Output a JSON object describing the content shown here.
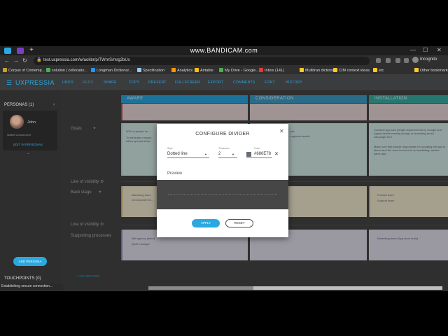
{
  "watermark": "www.BANDICAM.com",
  "browser": {
    "new_tab": "+",
    "url": "test.uxpressia.com/w/aokbr/p/TWnrS/m/g2bUs",
    "profile": "Incognito",
    "bookmarks": [
      {
        "label": "Corpus of Contemp...",
        "color": "#c9a227"
      },
      {
        "label": "solution | collocatio...",
        "color": "#4caf50"
      },
      {
        "label": "Longman Dictionar...",
        "color": "#2196f3"
      },
      {
        "label": "Specification",
        "color": "#90caf9"
      },
      {
        "label": "Analytics",
        "color": "#ff9800"
      },
      {
        "label": "Airtable",
        "color": "#ffc107"
      },
      {
        "label": "My Drive - Google...",
        "color": "#4caf50"
      },
      {
        "label": "Inbox (141)",
        "color": "#e53935"
      },
      {
        "label": "Multitran dictionary",
        "color": "#ffca28"
      },
      {
        "label": "CIM context ideas",
        "color": "#ffca28"
      },
      {
        "label": "etc",
        "color": "#ffca28"
      },
      {
        "label": "Other bookmarks",
        "color": "#ffca28"
      }
    ],
    "status": "Establishing secure connection..."
  },
  "app": {
    "brand": "UXPRESSIA",
    "toolbar": [
      {
        "label": "UNDO",
        "dim": false
      },
      {
        "label": "REDO",
        "dim": true
      },
      {
        "label": "SHARE",
        "dim": false
      },
      {
        "label": "COPY",
        "dim": false
      },
      {
        "label": "PRESENT",
        "dim": false
      },
      {
        "label": "FULLSCREEN",
        "dim": false
      },
      {
        "label": "EXPORT",
        "dim": false
      },
      {
        "label": "COMMENTS",
        "dim": false
      },
      {
        "label": "FONT",
        "dim": false
      },
      {
        "label": "HISTORY",
        "dim": false
      }
    ]
  },
  "sidebar": {
    "personas_title": "PERSONAS (1)",
    "persona": {
      "name": "John",
      "role": "Student & music lover",
      "edit": "EDIT IN PERSONAS"
    },
    "add_persona": "ADD PERSONA",
    "touchpoints_title": "TOUCHPOINTS (0)"
  },
  "map": {
    "stages": [
      {
        "label": "AWARE",
        "color": "#2aa9e0"
      },
      {
        "label": "CONSIDERATION",
        "color": "#3f9ec9"
      },
      {
        "label": "INSTALLATION",
        "color": "#37b0a6"
      }
    ],
    "rows": {
      "goals": "Goals",
      "line1": "Line of visibility",
      "backstage": "Back stage",
      "line2": "Line of visibility",
      "supporting": "Supporting processes"
    },
    "goal_texts": {
      "aware": "80% of people do...",
      "aware2": "To eliminate a negat... follow special advis...",
      "consid": "...ple",
      "consid2": "...regional results",
      "install": "Consider app size (length requirements by Google and Apple) before naming an app or launching an ad campaign for it",
      "install2": "Make sure that people responsible for updating the app to stores and the ones involved in ad marketing use the same app"
    },
    "backstage_texts": {
      "aware": "Marketing team",
      "aware2": "Development te...",
      "install": "Product team",
      "install2": "Support team"
    },
    "support_texts": {
      "aware": "Mkt agency (team)",
      "aware2": "QAM manager",
      "install": "Marketing team (App store texts)"
    },
    "add_section": "ADD SECTION"
  },
  "dialog": {
    "title": "CONFIGURE DIVIDER",
    "style_label": "Style",
    "style_value": "Dotted line",
    "thickness_label": "Thickness",
    "thickness_value": "2",
    "color_label": "Color",
    "color_value": "#686E78",
    "preview_label": "Preview",
    "apply": "APPLY",
    "reset": "RESET"
  }
}
